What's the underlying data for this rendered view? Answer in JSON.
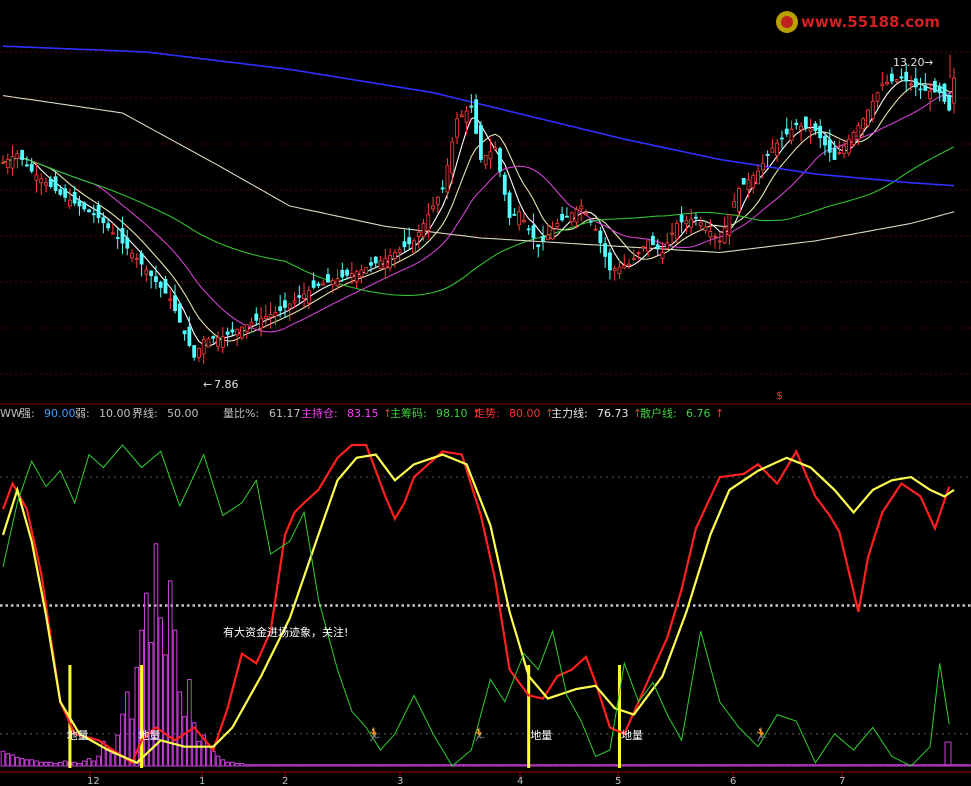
{
  "watermark": "www.55188.com",
  "price_panel": {
    "high_label": "13.20",
    "low_label": "7.86",
    "dollar_mark": "$"
  },
  "indicator_header": {
    "name": "WW",
    "items": [
      {
        "label": "强:",
        "value": "90.00",
        "color": "#3aa0ff",
        "arrow": ""
      },
      {
        "label": "弱:",
        "value": "10.00",
        "color": "#c0c0c0",
        "arrow": ""
      },
      {
        "label": "界线:",
        "value": "50.00",
        "color": "#c0c0c0",
        "arrow": ""
      },
      {
        "label": "量比%:",
        "value": "61.17",
        "color": "#c0c0c0",
        "arrow": ""
      },
      {
        "label": "主持仓:",
        "value": "83.15",
        "color": "#ff40ff",
        "arrow": "↑"
      },
      {
        "label": "主筹码:",
        "value": "98.10",
        "color": "#40d040",
        "arrow": "↑"
      },
      {
        "label": "走势:",
        "value": "80.00",
        "color": "#ff3030",
        "arrow": "↑"
      },
      {
        "label": "主力线:",
        "value": "76.73",
        "color": "#e8e8e8",
        "arrow": "↑"
      },
      {
        "label": "散户线:",
        "value": "6.76",
        "color": "#40d040",
        "arrow": "↑"
      }
    ]
  },
  "annotations": {
    "big_money": "有大资金进场迹象，关注!",
    "dibiao": "地量"
  },
  "x_axis_labels": [
    "12",
    "1",
    "2",
    "3",
    "4",
    "5",
    "6",
    "7"
  ],
  "chart_data": [
    {
      "type": "candlestick",
      "title": "",
      "ylim": [
        7.4,
        13.8
      ],
      "marked_high": 13.2,
      "marked_low": 7.86,
      "n": 200,
      "close_path": [
        [
          0,
          11.35
        ],
        [
          3,
          11.5
        ],
        [
          6,
          11.2
        ],
        [
          12,
          10.8
        ],
        [
          20,
          10.4
        ],
        [
          28,
          9.7
        ],
        [
          35,
          9.0
        ],
        [
          38,
          8.4
        ],
        [
          40,
          8.0
        ],
        [
          42,
          8.3
        ],
        [
          46,
          8.35
        ],
        [
          52,
          8.6
        ],
        [
          58,
          8.8
        ],
        [
          65,
          9.2
        ],
        [
          75,
          9.5
        ],
        [
          80,
          9.7
        ],
        [
          86,
          10.0
        ],
        [
          92,
          10.9
        ],
        [
          95,
          12.1
        ],
        [
          98,
          12.3
        ],
        [
          100,
          11.4
        ],
        [
          103,
          11.6
        ],
        [
          106,
          10.4
        ],
        [
          108,
          10.5
        ],
        [
          112,
          9.9
        ],
        [
          116,
          10.3
        ],
        [
          121,
          10.6
        ],
        [
          124,
          10.2
        ],
        [
          127,
          9.5
        ],
        [
          131,
          9.6
        ],
        [
          135,
          10.0
        ],
        [
          138,
          9.8
        ],
        [
          141,
          10.3
        ],
        [
          145,
          10.4
        ],
        [
          150,
          10.0
        ],
        [
          154,
          10.9
        ],
        [
          158,
          11.2
        ],
        [
          161,
          11.6
        ],
        [
          166,
          12.0
        ],
        [
          170,
          11.9
        ],
        [
          174,
          11.4
        ],
        [
          180,
          12.1
        ],
        [
          184,
          12.7
        ],
        [
          188,
          12.8
        ],
        [
          192,
          12.6
        ],
        [
          196,
          12.55
        ],
        [
          198,
          12.25
        ],
        [
          199,
          12.8
        ]
      ],
      "series": [
        {
          "name": "",
          "color": "#ffffff",
          "period": 5
        },
        {
          "name": "",
          "color": "#e6e6b4",
          "period": 10
        },
        {
          "name": "",
          "color": "#d040d0",
          "period": 20
        },
        {
          "name": "",
          "color": "#30c030",
          "period": 60
        },
        {
          "name": "",
          "color": "#d8d8c0",
          "path": [
            [
              0,
              12.5
            ],
            [
              25,
              12.2
            ],
            [
              45,
              11.3
            ],
            [
              60,
              10.6
            ],
            [
              80,
              10.25
            ],
            [
              100,
              10.05
            ],
            [
              130,
              9.9
            ],
            [
              150,
              9.8
            ],
            [
              170,
              10.0
            ],
            [
              190,
              10.3
            ],
            [
              199,
              10.5
            ]
          ]
        },
        {
          "name": "",
          "color": "#3030ff",
          "path": [
            [
              0,
              13.35
            ],
            [
              30,
              13.25
            ],
            [
              60,
              12.95
            ],
            [
              90,
              12.55
            ],
            [
              110,
              12.15
            ],
            [
              130,
              11.75
            ],
            [
              150,
              11.4
            ],
            [
              170,
              11.15
            ],
            [
              190,
              11.0
            ],
            [
              199,
              10.95
            ]
          ]
        }
      ]
    },
    {
      "type": "line",
      "title": "",
      "ylim": [
        0,
        100
      ],
      "levels": {
        "strong": 90,
        "weak": 10,
        "boundary": 50
      },
      "n": 200,
      "series": [
        {
          "name": "走势",
          "color": "#ff2020",
          "points": [
            [
              0,
              80
            ],
            [
              2,
              88
            ],
            [
              5,
              80
            ],
            [
              8,
              60
            ],
            [
              12,
              20
            ],
            [
              15,
              10
            ],
            [
              20,
              8
            ],
            [
              24,
              4
            ],
            [
              27,
              1
            ],
            [
              29,
              8
            ],
            [
              32,
              12
            ],
            [
              36,
              8
            ],
            [
              40,
              12
            ],
            [
              44,
              5
            ],
            [
              47,
              18
            ],
            [
              50,
              35
            ],
            [
              53,
              32
            ],
            [
              56,
              42
            ],
            [
              59,
              72
            ],
            [
              61,
              79
            ],
            [
              63,
              82
            ],
            [
              66,
              86
            ],
            [
              70,
              96
            ],
            [
              73,
              100
            ],
            [
              76,
              100
            ],
            [
              80,
              84
            ],
            [
              82,
              77
            ],
            [
              84,
              82
            ],
            [
              86,
              90
            ],
            [
              92,
              98
            ],
            [
              96,
              97
            ],
            [
              100,
              78
            ],
            [
              103,
              58
            ],
            [
              106,
              30
            ],
            [
              110,
              22
            ],
            [
              113,
              21
            ],
            [
              116,
              28
            ],
            [
              119,
              30
            ],
            [
              122,
              34
            ],
            [
              124,
              26
            ],
            [
              127,
              12
            ],
            [
              130,
              10
            ],
            [
              133,
              20
            ],
            [
              136,
              30
            ],
            [
              139,
              40
            ],
            [
              142,
              55
            ],
            [
              145,
              74
            ],
            [
              150,
              90
            ],
            [
              155,
              91
            ],
            [
              158,
              94
            ],
            [
              162,
              88
            ],
            [
              166,
              98
            ],
            [
              170,
              84
            ],
            [
              173,
              78
            ],
            [
              175,
              73
            ],
            [
              179,
              48
            ],
            [
              181,
              65
            ],
            [
              184,
              79
            ],
            [
              188,
              88
            ],
            [
              192,
              84
            ],
            [
              195,
              74
            ],
            [
              198,
              87
            ]
          ]
        },
        {
          "name": "主力线",
          "color": "#ffff50",
          "points": [
            [
              0,
              72
            ],
            [
              3,
              86
            ],
            [
              6,
              70
            ],
            [
              9,
              47
            ],
            [
              12,
              20
            ],
            [
              16,
              10
            ],
            [
              22,
              5
            ],
            [
              28,
              1
            ],
            [
              33,
              8
            ],
            [
              38,
              6
            ],
            [
              44,
              6
            ],
            [
              48,
              12
            ],
            [
              54,
              28
            ],
            [
              60,
              46
            ],
            [
              66,
              72
            ],
            [
              70,
              89
            ],
            [
              74,
              96
            ],
            [
              78,
              97
            ],
            [
              82,
              89
            ],
            [
              86,
              94
            ],
            [
              92,
              97
            ],
            [
              97,
              94
            ],
            [
              102,
              75
            ],
            [
              106,
              48
            ],
            [
              110,
              28
            ],
            [
              114,
              21
            ],
            [
              120,
              24
            ],
            [
              124,
              25
            ],
            [
              128,
              18
            ],
            [
              132,
              16
            ],
            [
              138,
              28
            ],
            [
              143,
              48
            ],
            [
              148,
              72
            ],
            [
              152,
              86
            ],
            [
              158,
              92
            ],
            [
              164,
              96
            ],
            [
              169,
              93
            ],
            [
              174,
              86
            ],
            [
              178,
              79
            ],
            [
              182,
              86
            ],
            [
              186,
              89
            ],
            [
              190,
              90
            ],
            [
              194,
              86
            ],
            [
              197,
              84
            ],
            [
              199,
              86
            ]
          ]
        },
        {
          "name": "散户线",
          "color": "#30d030",
          "points": [
            [
              0,
              62
            ],
            [
              3,
              82
            ],
            [
              6,
              95
            ],
            [
              9,
              87
            ],
            [
              12,
              92
            ],
            [
              15,
              82
            ],
            [
              18,
              97
            ],
            [
              21,
              93
            ],
            [
              25,
              100
            ],
            [
              29,
              93
            ],
            [
              33,
              98
            ],
            [
              37,
              81
            ],
            [
              42,
              97
            ],
            [
              46,
              78
            ],
            [
              50,
              82
            ],
            [
              53,
              89
            ],
            [
              56,
              66
            ],
            [
              60,
              70
            ],
            [
              63,
              79
            ],
            [
              66,
              52
            ],
            [
              70,
              30
            ],
            [
              73,
              17
            ],
            [
              76,
              12
            ],
            [
              79,
              5
            ],
            [
              82,
              10
            ],
            [
              86,
              22
            ],
            [
              90,
              10
            ],
            [
              94,
              0
            ],
            [
              98,
              5
            ],
            [
              102,
              27
            ],
            [
              105,
              20
            ],
            [
              109,
              35
            ],
            [
              112,
              30
            ],
            [
              115,
              42
            ],
            [
              118,
              22
            ],
            [
              121,
              14
            ],
            [
              124,
              3
            ],
            [
              127,
              5
            ],
            [
              130,
              32
            ],
            [
              133,
              20
            ],
            [
              136,
              26
            ],
            [
              139,
              16
            ],
            [
              142,
              8
            ],
            [
              146,
              42
            ],
            [
              150,
              20
            ],
            [
              154,
              12
            ],
            [
              158,
              6
            ],
            [
              162,
              16
            ],
            [
              166,
              14
            ],
            [
              170,
              1
            ],
            [
              174,
              10
            ],
            [
              178,
              5
            ],
            [
              182,
              12
            ],
            [
              186,
              3
            ],
            [
              190,
              0
            ],
            [
              194,
              6
            ],
            [
              196,
              32
            ],
            [
              198,
              13
            ]
          ]
        }
      ],
      "volume_bars": [
        12,
        10,
        9,
        7,
        6,
        5,
        5,
        4,
        3,
        3,
        3,
        2,
        3,
        4,
        3,
        3,
        2,
        4,
        6,
        4,
        8,
        20,
        14,
        10,
        25,
        42,
        60,
        38,
        80,
        110,
        140,
        100,
        180,
        120,
        90,
        150,
        110,
        60,
        40,
        70,
        35,
        20,
        25,
        16,
        12,
        8,
        5,
        3,
        3,
        2,
        2,
        1,
        1,
        1,
        1,
        1,
        1,
        1,
        1,
        1,
        1,
        1,
        1,
        1,
        1,
        1,
        1,
        1,
        1,
        1,
        1,
        1,
        1,
        1,
        1,
        1,
        1,
        1,
        1,
        1,
        1,
        1,
        1,
        1,
        1,
        1,
        1,
        1,
        1,
        1,
        1,
        1,
        1,
        1,
        1,
        1,
        1,
        1,
        1,
        1,
        1,
        1,
        1,
        1,
        1,
        1,
        1,
        1,
        1,
        1,
        1,
        1,
        1,
        1,
        1,
        1,
        1,
        1,
        1,
        1,
        1,
        1,
        1,
        1,
        1,
        1,
        1,
        1,
        1,
        1,
        1,
        1,
        1,
        1,
        1,
        1,
        1,
        1,
        1,
        1,
        1,
        1,
        1,
        1,
        1,
        1,
        1,
        1,
        1,
        1,
        1,
        1,
        1,
        1,
        1,
        1,
        1,
        1,
        1,
        1,
        1,
        1,
        1,
        1,
        1,
        1,
        1,
        1,
        1,
        1,
        1,
        1,
        1,
        1,
        1,
        1,
        1,
        1,
        1,
        1,
        1,
        1,
        1,
        1,
        1,
        1,
        1,
        1,
        1,
        1,
        1,
        1,
        1,
        1,
        1,
        1,
        1,
        1,
        1,
        1,
        1,
        1,
        1,
        1,
        1,
        1,
        1,
        1,
        1,
        1
      ],
      "yellow_markers": [
        14,
        29,
        110,
        129
      ],
      "dibiao_positions": [
        15,
        30,
        112,
        131
      ],
      "runner_positions": [
        77,
        99,
        158
      ]
    }
  ]
}
